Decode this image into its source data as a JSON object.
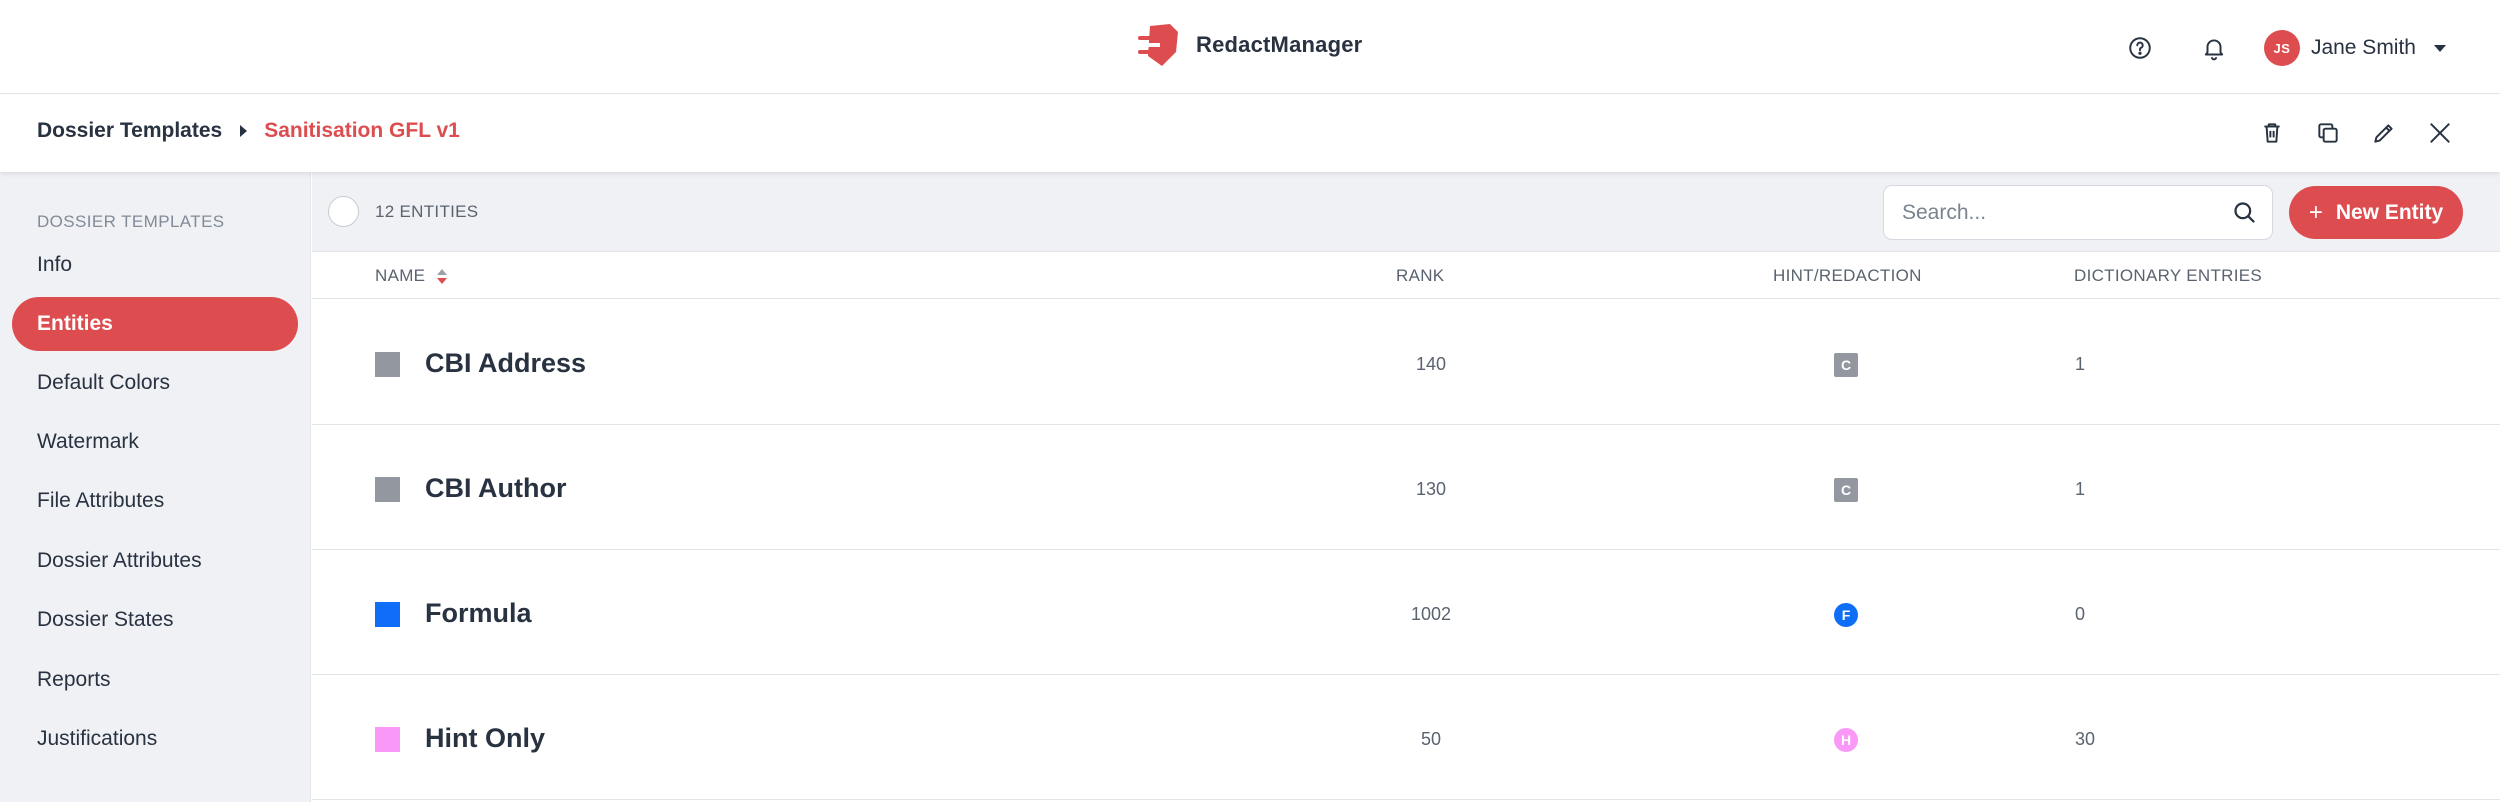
{
  "app": {
    "name": "RedactManager",
    "brand_color": "#dd4d50"
  },
  "topbar": {
    "help_icon": "help-circle-icon",
    "bell_icon": "bell-icon",
    "user": {
      "initials": "JS",
      "name": "Jane Smith"
    }
  },
  "breadcrumb": {
    "root": "Dossier Templates",
    "current": "Sanitisation GFL v1",
    "actions": [
      "trash-icon",
      "copy-icon",
      "edit-icon",
      "close-icon"
    ]
  },
  "sidebar": {
    "heading": "DOSSIER TEMPLATES",
    "items": [
      {
        "label": "Info",
        "active": false
      },
      {
        "label": "Entities",
        "active": true
      },
      {
        "label": "Default Colors",
        "active": false
      },
      {
        "label": "Watermark",
        "active": false
      },
      {
        "label": "File Attributes",
        "active": false
      },
      {
        "label": "Dossier Attributes",
        "active": false
      },
      {
        "label": "Dossier States",
        "active": false
      },
      {
        "label": "Reports",
        "active": false
      },
      {
        "label": "Justifications",
        "active": false
      }
    ]
  },
  "list": {
    "count_label": "12 ENTITIES",
    "search_placeholder": "Search...",
    "new_button_label": "New Entity",
    "columns": {
      "name": "NAME",
      "rank": "RANK",
      "hint": "HINT/REDACTION",
      "dict": "DICTIONARY ENTRIES"
    },
    "rows": [
      {
        "name": "CBI Address",
        "color": "#9398a0",
        "rank": "140",
        "hint_letter": "C",
        "hint_color": "#9398a0",
        "hint_shape": "square",
        "dict_entries": "1"
      },
      {
        "name": "CBI Author",
        "color": "#9398a0",
        "rank": "130",
        "hint_letter": "C",
        "hint_color": "#9398a0",
        "hint_shape": "square",
        "dict_entries": "1"
      },
      {
        "name": "Formula",
        "color": "#0f6ef7",
        "rank": "1002",
        "hint_letter": "F",
        "hint_color": "#0f6ef7",
        "hint_shape": "circle",
        "dict_entries": "0"
      },
      {
        "name": "Hint Only",
        "color": "#fa98f7",
        "rank": "50",
        "hint_letter": "H",
        "hint_color": "#fa98f7",
        "hint_shape": "circle",
        "dict_entries": "30"
      }
    ]
  }
}
